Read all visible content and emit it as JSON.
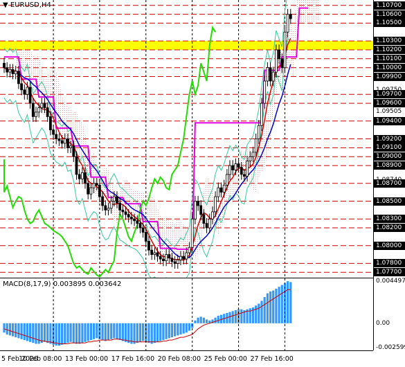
{
  "symbol": "EURUSD,H4",
  "indicator": "MACD(8,17,9) 0.003895 0.003642",
  "price_labels": [
    {
      "text": "1.10700",
      "style": "box",
      "price": 1.107
    },
    {
      "text": "1.10600",
      "style": "box",
      "price": 1.106
    },
    {
      "text": "1.10500",
      "style": "box",
      "price": 1.105
    },
    {
      "text": "1.10300",
      "style": "box",
      "price": 1.103
    },
    {
      "text": "1.10200",
      "style": "box",
      "price": 1.102
    },
    {
      "text": "1.10100",
      "style": "box",
      "price": 1.101
    },
    {
      "text": "1.10000",
      "style": "box",
      "price": 1.1
    },
    {
      "text": "1.09900",
      "style": "box",
      "price": 1.099
    },
    {
      "text": "1.09750",
      "style": "plain",
      "price": 1.0975
    },
    {
      "text": "1.09700",
      "style": "box",
      "price": 1.097
    },
    {
      "text": "1.09600",
      "style": "box",
      "price": 1.096
    },
    {
      "text": "1.09505",
      "style": "plain",
      "price": 1.09505
    },
    {
      "text": "1.09400",
      "style": "box",
      "price": 1.094
    },
    {
      "text": "1.09200",
      "style": "box",
      "price": 1.092
    },
    {
      "text": "1.09100",
      "style": "box",
      "price": 1.091
    },
    {
      "text": "1.09000",
      "style": "box",
      "price": 1.09
    },
    {
      "text": "1.08900",
      "style": "box",
      "price": 1.089
    },
    {
      "text": "1.08740",
      "style": "plain",
      "price": 1.0874
    },
    {
      "text": "1.08700",
      "style": "box",
      "price": 1.087
    },
    {
      "text": "1.08500",
      "style": "box",
      "price": 1.085
    },
    {
      "text": "1.08300",
      "style": "box",
      "price": 1.083
    },
    {
      "text": "1.08200",
      "style": "box",
      "price": 1.082
    },
    {
      "text": "1.08000",
      "style": "box",
      "price": 1.08
    },
    {
      "text": "1.07800",
      "style": "box",
      "price": 1.078
    },
    {
      "text": "1.07700",
      "style": "box",
      "price": 1.077
    }
  ],
  "macd_labels": [
    {
      "text": "0.004497",
      "value": 0.004497
    },
    {
      "text": "0.00",
      "value": 0.0
    },
    {
      "text": "-0.002599",
      "value": -0.002599
    }
  ],
  "time_labels": [
    {
      "text": "5 Feb 2020",
      "bar": 0
    },
    {
      "text": "10 Feb 08:00",
      "bar": 17
    },
    {
      "text": "13 Feb 00:00",
      "bar": 33
    },
    {
      "text": "17 Feb 16:00",
      "bar": 49
    },
    {
      "text": "20 Feb 08:00",
      "bar": 65
    },
    {
      "text": "25 Feb 00:00",
      "bar": 81
    },
    {
      "text": "27 Feb 16:00",
      "bar": 97
    }
  ],
  "colors": {
    "candle_body": "#000000",
    "sr_lines": "#cc0000",
    "yellow_zone": "#ffff00",
    "magenta_line": "#e000e0",
    "green_line": "#22dd00",
    "red_line": "#dd0000",
    "blue_line": "#0000cc",
    "teal_line": "#33cc99",
    "cloud_dots": "#e8a0a0",
    "macd_hist": "#3399ff",
    "macd_signal": "#cc0000",
    "vgrid": "#000000"
  },
  "series": {
    "close": [
      1.1,
      1.0995,
      1.0998,
      1.0993,
      1.0996,
      1.0982,
      1.0975,
      1.097,
      1.0978,
      1.096,
      1.0945,
      1.095,
      1.0955,
      1.096,
      1.0955,
      1.0945,
      1.093,
      1.0925,
      1.092,
      1.0918,
      1.0915,
      1.092,
      1.091,
      1.0912,
      1.09,
      1.088,
      1.0875,
      1.0882,
      1.087,
      1.0858,
      1.0865,
      1.087,
      1.0868,
      1.0855,
      1.0845,
      1.084,
      1.0842,
      1.085,
      1.0855,
      1.0848,
      1.084,
      1.0838,
      1.0835,
      1.0832,
      1.083,
      1.0828,
      1.0825,
      1.082,
      1.0815,
      1.0805,
      1.0795,
      1.079,
      1.0792,
      1.0788,
      1.0785,
      1.0783,
      1.079,
      1.0786,
      1.0782,
      1.078,
      1.0784,
      1.0788,
      1.0785,
      1.0792,
      1.0798,
      1.083,
      1.085,
      1.0845,
      1.0835,
      1.0825,
      1.082,
      1.083,
      1.0838,
      1.0855,
      1.0865,
      1.086,
      1.0868,
      1.088,
      1.089,
      1.0885,
      1.0892,
      1.0888,
      1.088,
      1.0878,
      1.0895,
      1.09,
      1.0905,
      1.092,
      1.0935,
      1.096,
      1.0985,
      1.1,
      1.0985,
      1.0995,
      1.102,
      1.101,
      1.1,
      1.104,
      1.106,
      1.1055
    ],
    "open": [
      1.1005,
      1.1,
      1.0995,
      1.0998,
      1.0993,
      1.0996,
      1.0982,
      1.0975,
      1.097,
      1.0978,
      1.096,
      1.0945,
      1.095,
      1.0955,
      1.096,
      1.0955,
      1.0945,
      1.093,
      1.0925,
      1.092,
      1.0918,
      1.0915,
      1.092,
      1.091,
      1.0912,
      1.09,
      1.088,
      1.0875,
      1.0882,
      1.087,
      1.0858,
      1.0865,
      1.087,
      1.0868,
      1.0855,
      1.0845,
      1.084,
      1.0842,
      1.085,
      1.0855,
      1.0848,
      1.084,
      1.0838,
      1.0835,
      1.0832,
      1.083,
      1.0828,
      1.0825,
      1.082,
      1.0815,
      1.0805,
      1.0795,
      1.079,
      1.0792,
      1.0788,
      1.0785,
      1.0783,
      1.079,
      1.0786,
      1.0782,
      1.078,
      1.0784,
      1.0788,
      1.0785,
      1.0792,
      1.0798,
      1.083,
      1.085,
      1.0845,
      1.0835,
      1.0825,
      1.082,
      1.083,
      1.0838,
      1.0855,
      1.0865,
      1.086,
      1.0868,
      1.088,
      1.089,
      1.0885,
      1.0892,
      1.0888,
      1.088,
      1.0878,
      1.0895,
      1.09,
      1.0905,
      1.092,
      1.0935,
      1.096,
      1.0985,
      1.1,
      1.0985,
      1.0995,
      1.102,
      1.101,
      1.1,
      1.104,
      1.106
    ],
    "macd": [
      -0.001,
      -0.0012,
      -0.0013,
      -0.0014,
      -0.0015,
      -0.0016,
      -0.0017,
      -0.0018,
      -0.0019,
      -0.002,
      -0.0021,
      -0.0022,
      -0.0022,
      -0.0021,
      -0.002,
      -0.0021,
      -0.0022,
      -0.0023,
      -0.0024,
      -0.0024,
      -0.0023,
      -0.0022,
      -0.0021,
      -0.002,
      -0.0021,
      -0.0022,
      -0.0022,
      -0.0021,
      -0.002,
      -0.0019,
      -0.0018,
      -0.0017,
      -0.0016,
      -0.0017,
      -0.0018,
      -0.0019,
      -0.0018,
      -0.0017,
      -0.0016,
      -0.0017,
      -0.0018,
      -0.0019,
      -0.002,
      -0.0021,
      -0.0022,
      -0.0022,
      -0.0021,
      -0.002,
      -0.0019,
      -0.002,
      -0.0021,
      -0.0022,
      -0.0021,
      -0.002,
      -0.0019,
      -0.0018,
      -0.0017,
      -0.0016,
      -0.0015,
      -0.0014,
      -0.0013,
      -0.0012,
      -0.0011,
      -0.001,
      -0.0008,
      -0.0005,
      0.0003,
      0.0006,
      0.0007,
      0.0006,
      0.0004,
      0.0003,
      0.0004,
      0.0006,
      0.0008,
      0.0009,
      0.001,
      0.0011,
      0.0012,
      0.0013,
      0.0014,
      0.0015,
      0.0015,
      0.0014,
      0.0015,
      0.0016,
      0.0017,
      0.0019,
      0.0021,
      0.0024,
      0.0028,
      0.0032,
      0.0034,
      0.0035,
      0.0037,
      0.0039,
      0.0041,
      0.0043,
      0.0045,
      0.0044
    ],
    "signal": [
      -0.0006,
      -0.0007,
      -0.0008,
      -0.0009,
      -0.001,
      -0.0011,
      -0.0012,
      -0.0013,
      -0.0014,
      -0.0015,
      -0.0016,
      -0.0017,
      -0.0018,
      -0.0019,
      -0.0019,
      -0.002,
      -0.002,
      -0.0021,
      -0.0021,
      -0.0022,
      -0.0022,
      -0.0022,
      -0.0022,
      -0.0021,
      -0.0021,
      -0.0021,
      -0.0021,
      -0.0021,
      -0.0021,
      -0.002,
      -0.002,
      -0.0019,
      -0.0019,
      -0.0018,
      -0.0018,
      -0.0018,
      -0.0018,
      -0.0018,
      -0.0017,
      -0.0017,
      -0.0017,
      -0.0018,
      -0.0018,
      -0.0019,
      -0.0019,
      -0.002,
      -0.002,
      -0.002,
      -0.002,
      -0.002,
      -0.002,
      -0.002,
      -0.002,
      -0.002,
      -0.002,
      -0.0019,
      -0.0019,
      -0.0018,
      -0.0018,
      -0.0017,
      -0.0016,
      -0.0015,
      -0.0015,
      -0.0014,
      -0.0013,
      -0.0012,
      -0.0009,
      -0.0006,
      -0.0004,
      -0.0002,
      -0.0001,
      0.0,
      0.0001,
      0.0002,
      0.0003,
      0.0004,
      0.0005,
      0.0006,
      0.0007,
      0.0008,
      0.0009,
      0.001,
      0.0011,
      0.0012,
      0.0013,
      0.0013,
      0.0014,
      0.0015,
      0.0016,
      0.0018,
      0.002,
      0.0022,
      0.0024,
      0.0026,
      0.0028,
      0.003,
      0.0032,
      0.0034,
      0.0036,
      0.0036
    ]
  }
}
